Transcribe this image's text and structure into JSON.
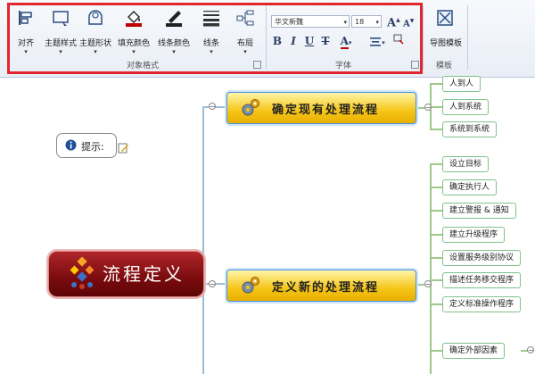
{
  "ribbon": {
    "object_style_buttons": [
      {
        "label": "对齐",
        "icon": "align-icon"
      },
      {
        "label": "主题样式",
        "icon": "topic-style-icon"
      },
      {
        "label": "主题形状",
        "icon": "topic-shape-icon"
      },
      {
        "label": "填充颜色",
        "icon": "fill-color-icon"
      },
      {
        "label": "线条颜色",
        "icon": "line-color-icon"
      },
      {
        "label": "线条",
        "icon": "line-style-icon"
      },
      {
        "label": "布局",
        "icon": "layout-icon"
      }
    ],
    "object_style_group_label": "对象格式",
    "font": {
      "family": "华文新魏",
      "size": "18",
      "grow": "A",
      "shrink": "A",
      "bold": "B",
      "italic": "I",
      "underline": "U",
      "strike": "T",
      "color": "A",
      "group_label": "字体"
    },
    "template": {
      "label": "导图模板",
      "group_label": "模板",
      "icon": "template-icon"
    },
    "colors": {
      "accent_red": "#e0262f",
      "fill_bucket": "#c00000"
    }
  },
  "map": {
    "hint_label": "提示:",
    "root_label": "流程定义",
    "branches": [
      {
        "label": "确定现有处理流程",
        "leaves": [
          "人到人",
          "人到系统",
          "系统到系统"
        ]
      },
      {
        "label": "定义新的处理流程",
        "leaves": [
          "设立目标",
          "确定执行人",
          "建立警报 & 通知",
          "建立升级程序",
          "设置服务级别协议",
          "描述任务移交程序",
          "定义标准操作程序"
        ]
      }
    ],
    "extra_leaf": "确定外部因素",
    "colors": {
      "root": "#8b0f12",
      "branch": "#f5c518",
      "branch_border": "#4a90d9",
      "leaf_border": "#7fc28a"
    }
  }
}
